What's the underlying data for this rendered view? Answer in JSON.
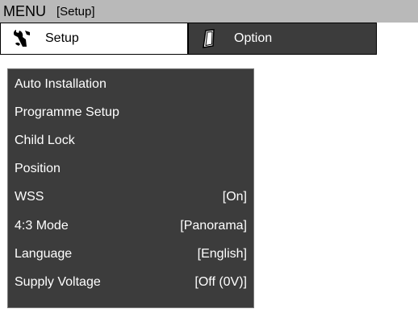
{
  "title": {
    "menu": "MENU",
    "section": "[Setup]"
  },
  "tabs": [
    {
      "label": "Setup",
      "icon": "wrench-icon",
      "selected": true
    },
    {
      "label": "Option",
      "icon": "pencil-icon",
      "selected": false
    }
  ],
  "menu": {
    "items": [
      {
        "label": "Auto Installation",
        "value": ""
      },
      {
        "label": "Programme Setup",
        "value": ""
      },
      {
        "label": "Child Lock",
        "value": ""
      },
      {
        "label": "Position",
        "value": ""
      },
      {
        "label": "WSS",
        "value": "[On]"
      },
      {
        "label": "4:3 Mode",
        "value": "[Panorama]"
      },
      {
        "label": "Language",
        "value": "[English]"
      },
      {
        "label": "Supply Voltage",
        "value": "[Off (0V)]"
      }
    ]
  },
  "colors": {
    "title_bar": "#b9b9b9",
    "panel": "#3c3c3c",
    "selected_tab": "#ffffff",
    "text_light": "#ffffff",
    "text_dark": "#000000"
  }
}
